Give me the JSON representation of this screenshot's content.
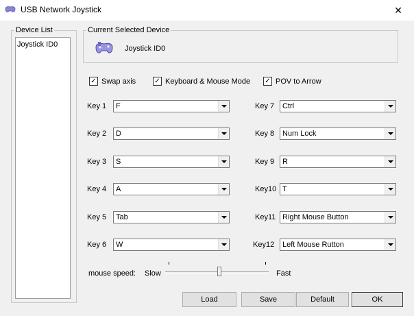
{
  "window": {
    "title": "USB Network Joystick",
    "close": "✕"
  },
  "device_list": {
    "label": "Device List",
    "items": [
      "Joystick ID0"
    ]
  },
  "current_device": {
    "label": "Current Selected Device",
    "name": "Joystick ID0"
  },
  "options": {
    "swap_axis": {
      "label": "Swap axis",
      "checked": true
    },
    "keyboard_mouse": {
      "label": "Keyboard & Mouse Mode",
      "checked": true
    },
    "pov_arrow": {
      "label": "POV to Arrow",
      "checked": true
    }
  },
  "keys_left": [
    {
      "label": "Key 1",
      "value": "F"
    },
    {
      "label": "Key 2",
      "value": "D"
    },
    {
      "label": "Key 3",
      "value": "S"
    },
    {
      "label": "Key 4",
      "value": "A"
    },
    {
      "label": "Key 5",
      "value": "Tab"
    },
    {
      "label": "Key 6",
      "value": "W"
    }
  ],
  "keys_right": [
    {
      "label": "Key 7",
      "value": "Ctrl"
    },
    {
      "label": "Key 8",
      "value": "Num Lock"
    },
    {
      "label": "Key 9",
      "value": "R"
    },
    {
      "label": "Key10",
      "value": "T"
    },
    {
      "label": "Key11",
      "value": "Right Mouse Button"
    },
    {
      "label": "Key12",
      "value": "Left Mouse Rutton"
    }
  ],
  "mouse_speed": {
    "label": "mouse speed:",
    "min_label": "Slow",
    "max_label": "Fast",
    "level": 0.52
  },
  "buttons": {
    "load": "Load",
    "save": "Save",
    "default": "Default",
    "ok": "OK"
  }
}
